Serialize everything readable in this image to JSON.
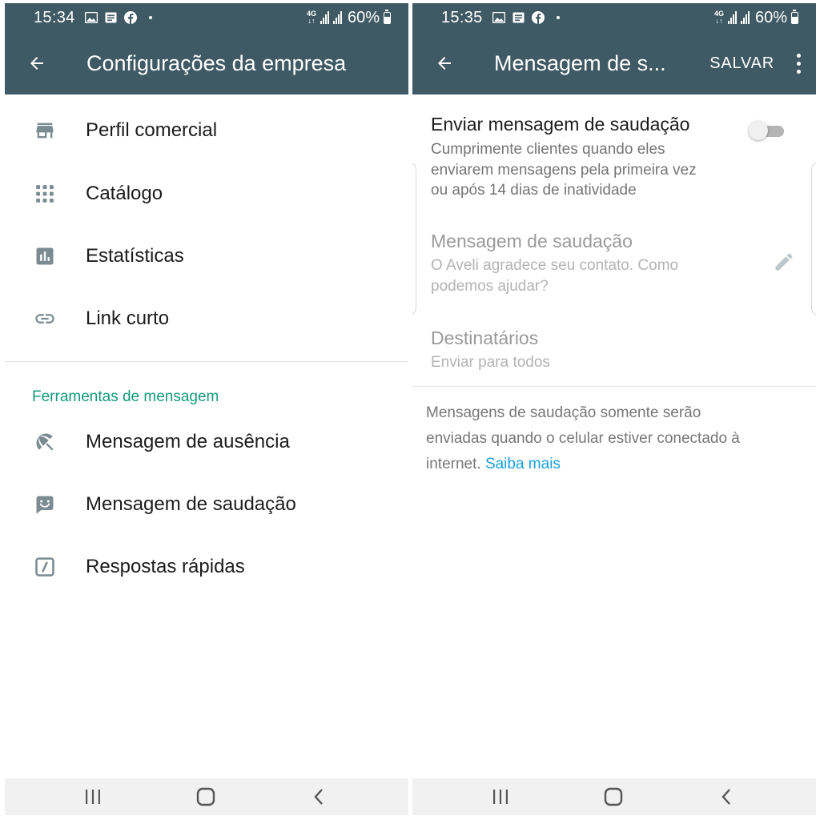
{
  "left": {
    "status": {
      "time": "15:34",
      "network": "4G",
      "battery": "60%"
    },
    "title": "Configurações da empresa",
    "items": [
      {
        "label": "Perfil comercial",
        "icon": "store-icon"
      },
      {
        "label": "Catálogo",
        "icon": "grid-dots-icon"
      },
      {
        "label": "Estatísticas",
        "icon": "bar-chart-icon"
      },
      {
        "label": "Link curto",
        "icon": "link-icon"
      }
    ],
    "section_header": "Ferramentas de mensagem",
    "tools": [
      {
        "label": "Mensagem de ausência",
        "icon": "beach-umbrella-icon"
      },
      {
        "label": "Mensagem de saudação",
        "icon": "smiley-message-icon"
      },
      {
        "label": "Respostas rápidas",
        "icon": "quick-reply-icon"
      }
    ]
  },
  "right": {
    "status": {
      "time": "15:35",
      "network": "4G",
      "battery": "60%"
    },
    "title": "Mensagem de s...",
    "save_label": "SALVAR",
    "send_greeting": {
      "title": "Enviar mensagem de saudação",
      "desc1": "Cumprimente clientes quando eles",
      "desc2": "enviarem mensagens pela primeira vez",
      "desc3": "ou após 14 dias de inatividade",
      "enabled": false
    },
    "greeting_message": {
      "title": "Mensagem de saudação",
      "text1": "O Aveli agradece seu contato. Como",
      "text2": "podemos ajudar?"
    },
    "recipients": {
      "title": "Destinatários",
      "value": "Enviar para todos"
    },
    "note": {
      "line1": "Mensagens de saudação somente serão",
      "line2": "enviadas quando o celular estiver conectado à",
      "line3": "internet.",
      "link": "Saiba mais"
    }
  },
  "colors": {
    "appbar": "#3f5a64",
    "accent_green": "#139a7c",
    "link_blue": "#1aa0d8",
    "icon_gray": "#7b8b92",
    "disabled_text": "#9a9a9a"
  }
}
